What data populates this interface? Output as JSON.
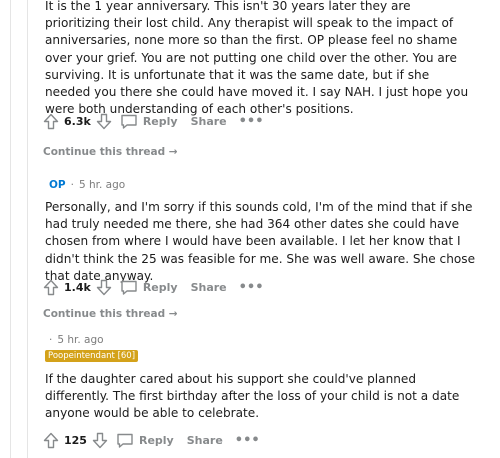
{
  "comments": [
    {
      "text": "It is the 1 year anniversary. This isn't 30 years later they are prioritizing their lost child. Any therapist will speak to the impact of anniversaries, none more so than the first. OP please feel no shame over your grief. You are not putting one child over the other. You are surviving. It is unfortunate that it was the same date, but if she needed you there she could have moved it. I say NAH. I just hope you were both understanding of each other's positions.",
      "score": "6.3k",
      "reply_label": "Reply",
      "share_label": "Share",
      "more_label": "•••",
      "continue_label": "Continue this thread →"
    },
    {
      "author_tag": "OP",
      "separator": "·",
      "timestamp": "5 hr. ago",
      "text": "Personally, and I'm sorry if this sounds cold, I'm of the mind that if she had truly needed me there, she had 364 other dates she could have chosen from where I would have been available. I let her know that I didn't think the 25 was feasible for me. She was well aware. She chose that date anyway.",
      "score": "1.4k",
      "reply_label": "Reply",
      "share_label": "Share",
      "more_label": "•••",
      "continue_label": "Continue this thread →"
    },
    {
      "separator": "·",
      "timestamp": "5 hr. ago",
      "flair": "Poopeintendant [60]",
      "text": "If the daughter cared about his support she could've planned differently. The first birthday after the loss of your child is not a date anyone would be able to celebrate.",
      "score": "125",
      "reply_label": "Reply",
      "share_label": "Share",
      "more_label": "•••"
    }
  ],
  "colors": {
    "op": "#0079d3",
    "flair_bg": "#d4a21a",
    "muted": "#878a8c",
    "text": "#1c1c1c"
  },
  "icons": [
    "upvote-icon",
    "downvote-icon",
    "comment-icon"
  ]
}
